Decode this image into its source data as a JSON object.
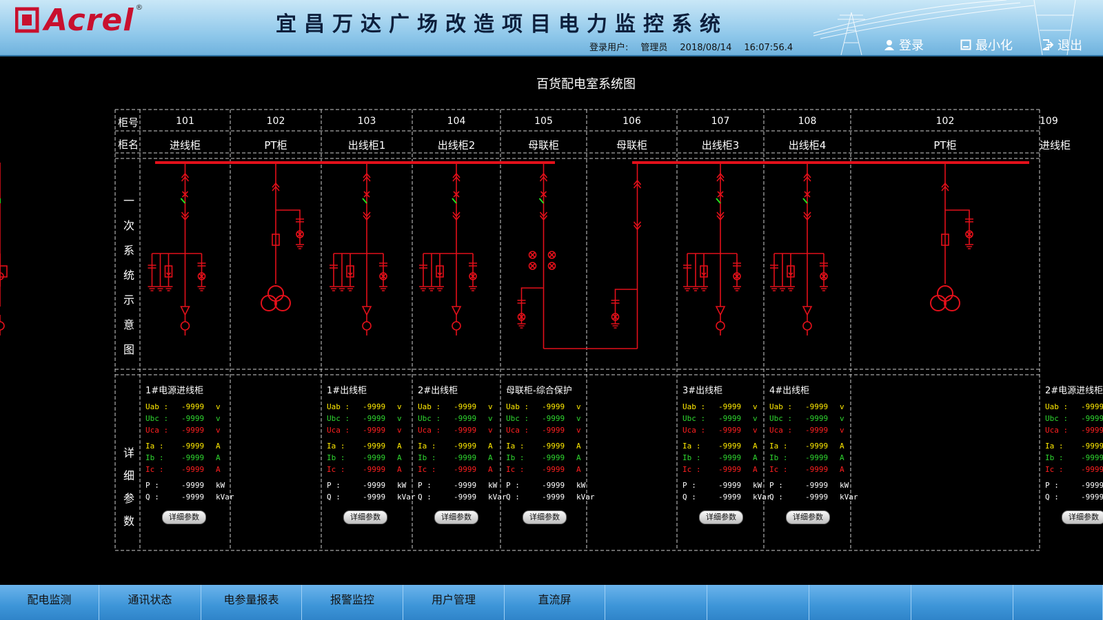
{
  "header": {
    "logo_text": "Acrel",
    "logo_reg": "®",
    "title": "宜昌万达广场改造项目电力监控系统",
    "login_user_label": "登录用户:",
    "user": "管理员",
    "date": "2018/08/14",
    "time": "16:07:56.4",
    "login_label": "登录",
    "minimize_label": "最小化",
    "exit_label": "退出"
  },
  "diagram": {
    "title": "百货配电室系统图",
    "row_labels": {
      "number": "柜号",
      "name": "柜名",
      "primary": [
        "一",
        "次",
        "系",
        "统",
        "示",
        "意",
        "图"
      ],
      "detail": [
        "详",
        "细",
        "参",
        "数"
      ]
    },
    "cabinets": [
      {
        "num": "101",
        "name": "进线柜"
      },
      {
        "num": "102",
        "name": "PT柜"
      },
      {
        "num": "103",
        "name": "出线柜1"
      },
      {
        "num": "104",
        "name": "出线柜2"
      },
      {
        "num": "105",
        "name": "母联柜"
      },
      {
        "num": "106",
        "name": "母联柜"
      },
      {
        "num": "107",
        "name": "出线柜3"
      },
      {
        "num": "108",
        "name": "出线柜4"
      },
      {
        "num": "102",
        "name": "PT柜"
      },
      {
        "num": "109",
        "name": "进线柜"
      }
    ],
    "detail_button_label": "详细参数",
    "detail_panels": [
      {
        "title": "1#电源进线柜"
      },
      {
        "title": "1#出线柜"
      },
      {
        "title": "2#出线柜"
      },
      {
        "title": "母联柜-综合保护"
      },
      {
        "title": "3#出线柜"
      },
      {
        "title": "4#出线柜"
      },
      {
        "title": "2#电源进线柜"
      }
    ],
    "params": [
      {
        "label": "Uab :",
        "value": "-9999",
        "unit": "v",
        "color": "#ffea00"
      },
      {
        "label": "Ubc :",
        "value": "-9999",
        "unit": "v",
        "color": "#2fd62f"
      },
      {
        "label": "Uca :",
        "value": "-9999",
        "unit": "v",
        "color": "#ff2020"
      },
      {
        "label": "Ia :",
        "value": "-9999",
        "unit": "A",
        "color": "#ffea00"
      },
      {
        "label": "Ib :",
        "value": "-9999",
        "unit": "A",
        "color": "#2fd62f"
      },
      {
        "label": "Ic :",
        "value": "-9999",
        "unit": "A",
        "color": "#ff2020"
      },
      {
        "label": "P  :",
        "value": "-9999",
        "unit": "kW",
        "color": "#ffffff"
      },
      {
        "label": "Q  :",
        "value": "-9999",
        "unit": "kVar",
        "color": "#ffffff"
      }
    ]
  },
  "nav": [
    "配电监测",
    "通讯状态",
    "电参量报表",
    "报警监控",
    "用户管理",
    "直流屏",
    "",
    "",
    "",
    "",
    ""
  ],
  "colors": {
    "busbar": "#e3101a",
    "grid": "#cfcfcf",
    "breaker_status": "#20e020",
    "header_bg": "#8ec7ea",
    "nav_bg": "#3d95d8"
  }
}
